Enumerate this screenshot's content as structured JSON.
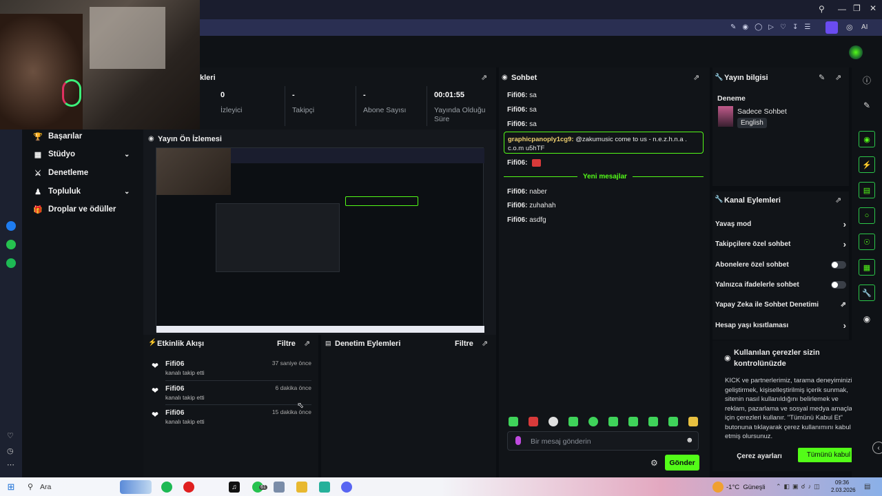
{
  "browser": {
    "ai_label": "AI"
  },
  "sidebar": {
    "items": [
      {
        "label": "Başarılar",
        "icon": "trophy-icon",
        "expand": false
      },
      {
        "label": "Stüdyo",
        "icon": "studio-icon",
        "expand": true
      },
      {
        "label": "Denetleme",
        "icon": "sword-icon",
        "expand": false
      },
      {
        "label": "Topluluk",
        "icon": "community-icon",
        "expand": true
      },
      {
        "label": "Droplar ve ödüller",
        "icon": "gift-icon",
        "expand": false
      }
    ]
  },
  "stats": {
    "title_partial": "kleri",
    "items": [
      {
        "value": "0",
        "label": "İzleyici"
      },
      {
        "value": "-",
        "label": "Takipçi"
      },
      {
        "value": "-",
        "label": "Abone Sayısı"
      },
      {
        "value": "00:01:55",
        "label": "Yayında Olduğu Süre"
      }
    ]
  },
  "preview": {
    "title": "Yayın Ön İzlemesi"
  },
  "activity": {
    "title": "Etkinlik Akışı",
    "filter": "Filtre",
    "events": [
      {
        "name": "Fifi06",
        "desc": "kanalı takip etti",
        "time": "37 saniye önce"
      },
      {
        "name": "Fifi06",
        "desc": "kanalı takip etti",
        "time": "6 dakika önce"
      },
      {
        "name": "Fifi06",
        "desc": "kanalı takip etti",
        "time": "15 dakika önce"
      }
    ]
  },
  "moderation": {
    "title": "Denetim Eylemleri",
    "filter": "Filtre"
  },
  "chat": {
    "title": "Sohbet",
    "messages_top": [
      {
        "user": "Fifi06:",
        "text": " sa"
      },
      {
        "user": "Fifi06:",
        "text": " sa"
      },
      {
        "user": "Fifi06:",
        "text": " sa"
      }
    ],
    "highlight": {
      "user": "graphicpanoply1cg9:",
      "text": " @zakumusic come to us - n.e.z.h.n.a . c.o.m u5hTF"
    },
    "emote_msg": {
      "user": "Fifi06:"
    },
    "divider": "Yeni mesajlar",
    "messages_new": [
      {
        "user": "Fifi06:",
        "text": " naber"
      },
      {
        "user": "Fifi06:",
        "text": " zuhahah"
      },
      {
        "user": "Fifi06:",
        "text": " asdfg"
      }
    ],
    "input_placeholder": "Bir mesaj gönderin",
    "send": "Gönder"
  },
  "stream_info": {
    "title": "Yayın bilgisi",
    "stream_title": "Deneme",
    "category": "Sadece Sohbet",
    "language": "English"
  },
  "channel_actions": {
    "title": "Kanal Eylemleri",
    "items": [
      {
        "label": "Yavaş mod",
        "control": "arrow"
      },
      {
        "label": "Takipçilere özel sohbet",
        "control": "arrow"
      },
      {
        "label": "Abonelere özel sohbet",
        "control": "toggle"
      },
      {
        "label": "Yalnızca ifadelerle sohbet",
        "control": "toggle"
      },
      {
        "label": "Yapay Zeka ile Sohbet Denetimi",
        "control": "external"
      },
      {
        "label": "Hesap yaşı kısıtlaması",
        "control": "arrow"
      }
    ]
  },
  "cookie": {
    "title": "Kullanılan çerezler sizin kontrolünüzde",
    "body": "KICK ve partnerlerimiz, tarama deneyiminizi geliştirmek, kişiselleştirilmiş içerik sunmak, sitenin nasıl kullanıldığını belirlemek ve reklam, pazarlama ve sosyal medya amaçları için çerezleri kullanır. \"Tümünü Kabul Et\" butonuna tıklayarak çerez kullanımını kabul etmiş olursunuz.",
    "settings": "Çerez ayarları",
    "accept": "Tümünü kabul et"
  },
  "taskbar": {
    "search": "Ara",
    "weather": "-1°C  Güneşli",
    "time": "09:36",
    "date": "2.03.2026",
    "badge": "61"
  },
  "colors": {
    "accent": "#53fc18",
    "bg": "#0b0e12",
    "panel": "#111418"
  }
}
